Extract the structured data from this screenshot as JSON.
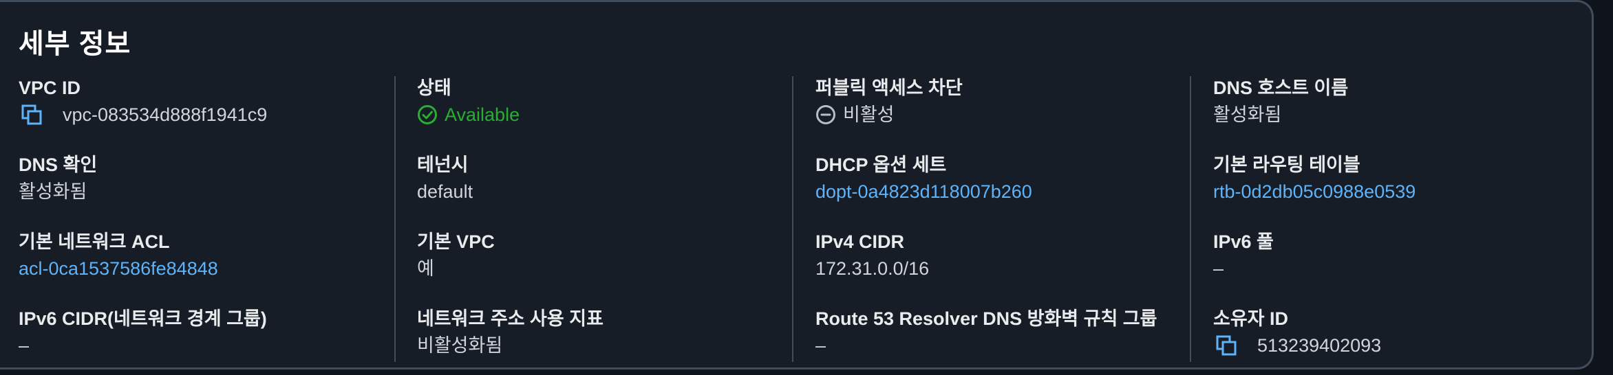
{
  "section": {
    "title": "세부 정보"
  },
  "columns": [
    {
      "fields": [
        {
          "label": "VPC ID",
          "value": "vpc-083534d888f1941c9",
          "kind": "copy"
        },
        {
          "label": "DNS 확인",
          "value": "활성화됨",
          "kind": "text"
        },
        {
          "label": "기본 네트워크 ACL",
          "value": "acl-0ca1537586fe84848",
          "kind": "link"
        },
        {
          "label": "IPv6 CIDR(네트워크 경계 그룹)",
          "value": "–",
          "kind": "text"
        }
      ]
    },
    {
      "fields": [
        {
          "label": "상태",
          "value": "Available",
          "kind": "success"
        },
        {
          "label": "테넌시",
          "value": "default",
          "kind": "text"
        },
        {
          "label": "기본 VPC",
          "value": "예",
          "kind": "text"
        },
        {
          "label": "네트워크 주소 사용 지표",
          "value": "비활성화됨",
          "kind": "text"
        }
      ]
    },
    {
      "fields": [
        {
          "label": "퍼블릭 액세스 차단",
          "value": "비활성",
          "kind": "disabled"
        },
        {
          "label": "DHCP 옵션 세트",
          "value": "dopt-0a4823d118007b260",
          "kind": "link"
        },
        {
          "label": "IPv4 CIDR",
          "value": "172.31.0.0/16",
          "kind": "text"
        },
        {
          "label": "Route 53 Resolver DNS 방화벽 규칙 그룹",
          "value": "–",
          "kind": "text"
        }
      ]
    },
    {
      "fields": [
        {
          "label": "DNS 호스트 이름",
          "value": "활성화됨",
          "kind": "text"
        },
        {
          "label": "기본 라우팅 테이블",
          "value": "rtb-0d2db05c0988e0539",
          "kind": "link"
        },
        {
          "label": "IPv6 풀",
          "value": "–",
          "kind": "text"
        },
        {
          "label": "소유자 ID",
          "value": "513239402093",
          "kind": "copy"
        }
      ]
    }
  ],
  "colors": {
    "background": "#0f141a",
    "panel": "#161d26",
    "link": "#5fb3f9",
    "success": "#29ad32",
    "divider": "#414d5c"
  },
  "icons": {
    "copy": "copy-icon",
    "success": "status-available-icon",
    "disabled": "status-disabled-icon"
  }
}
